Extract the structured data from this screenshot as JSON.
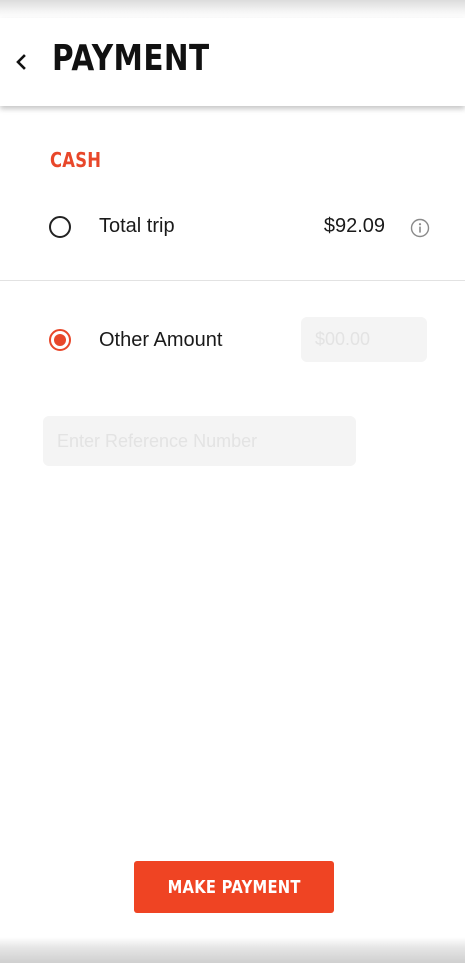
{
  "header": {
    "back_icon": "chevron-left-icon",
    "title": "PAYMENT"
  },
  "payment": {
    "section_label": "CASH",
    "options": [
      {
        "label": "Total trip",
        "amount": "$92.09",
        "selected": false,
        "info_icon": "info-circle-icon"
      },
      {
        "label": "Other Amount",
        "selected": true,
        "amount_input": {
          "value": "",
          "placeholder": "$00.00"
        }
      }
    ],
    "reference_input": {
      "value": "",
      "placeholder": "Enter Reference Number"
    }
  },
  "actions": {
    "make_payment_label": "MAKE PAYMENT"
  },
  "colors": {
    "accent": "#ef4423",
    "section_label": "#e8472a",
    "input_background": "#f4f4f4"
  }
}
